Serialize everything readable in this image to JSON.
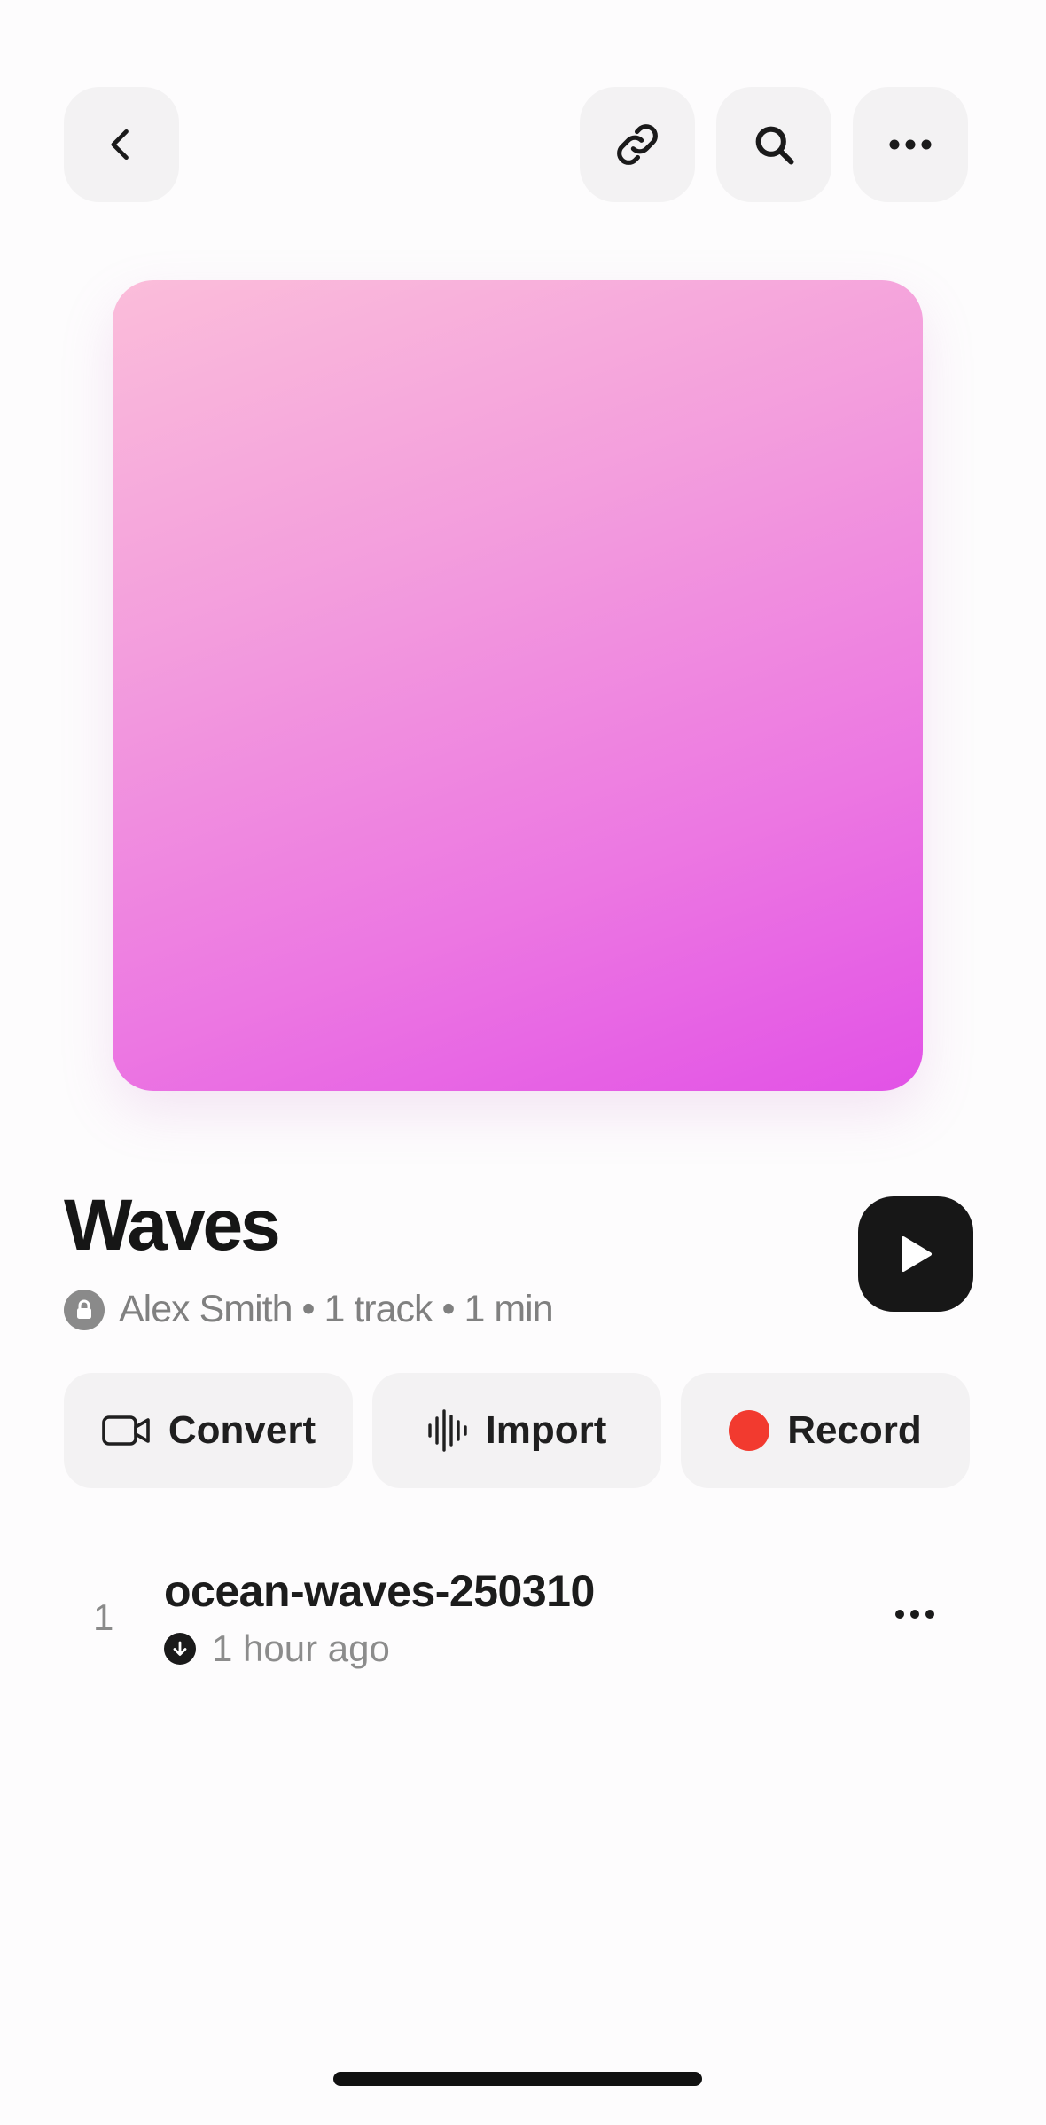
{
  "header": {
    "back_icon": "chevron-left-icon",
    "link_icon": "link-icon",
    "search_icon": "search-icon",
    "more_icon": "ellipsis-icon"
  },
  "playlist": {
    "title": "Waves",
    "owner": "Alex Smith",
    "track_count": "1 track",
    "duration": "1 min",
    "privacy_icon": "lock-icon",
    "cover_colors": [
      "#fbbdda",
      "#e252e6"
    ]
  },
  "actions": [
    {
      "label": "Convert",
      "icon": "video-camera-icon"
    },
    {
      "label": "Import",
      "icon": "waveform-icon"
    },
    {
      "label": "Record",
      "icon": "record-dot-icon",
      "color": "#f23a2f"
    }
  ],
  "tracks": [
    {
      "number": "1",
      "title": "ocean-waves-250310",
      "status_icon": "downloaded-icon",
      "time": "1 hour ago"
    }
  ]
}
